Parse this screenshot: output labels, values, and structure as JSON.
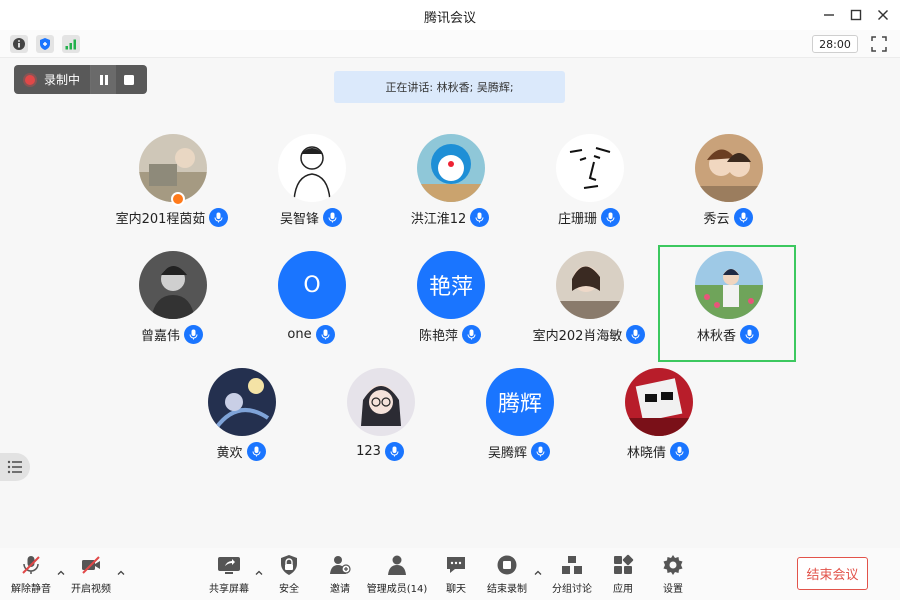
{
  "window": {
    "title": "腾讯会议"
  },
  "topbar": {
    "timer": "28:00"
  },
  "recording": {
    "label": "录制中"
  },
  "speaking": {
    "text": "正在讲话: 林秋香; 吴腾辉;"
  },
  "participants": [
    {
      "name": "室内201程茵茹",
      "avatar": "photo",
      "host": true
    },
    {
      "name": "吴智锋",
      "avatar": "sketch"
    },
    {
      "name": "洪江淮12",
      "avatar": "cartoon"
    },
    {
      "name": "庄珊珊",
      "avatar": "face-doodle"
    },
    {
      "name": "秀云",
      "avatar": "anime"
    },
    {
      "name": "曾嘉伟",
      "avatar": "photo"
    },
    {
      "name": "one",
      "avatar": "text",
      "initials": "O"
    },
    {
      "name": "陈艳萍",
      "avatar": "text",
      "initials": "艳萍"
    },
    {
      "name": "室内202肖海敏",
      "avatar": "photo"
    },
    {
      "name": "林秋香",
      "avatar": "photo",
      "active": true
    },
    {
      "name": "黄欢",
      "avatar": "illustration"
    },
    {
      "name": "123",
      "avatar": "illustration"
    },
    {
      "name": "吴腾辉",
      "avatar": "text",
      "initials": "腾辉"
    },
    {
      "name": "林晓倩",
      "avatar": "photo"
    }
  ],
  "toolbar": {
    "unmute": "解除静音",
    "video": "开启视频",
    "share": "共享屏幕",
    "security": "安全",
    "invite": "邀请",
    "members": "管理成员(14)",
    "chat": "聊天",
    "stop_record": "结束录制",
    "breakout": "分组讨论",
    "apps": "应用",
    "settings": "设置",
    "end_meeting": "结束会议"
  },
  "colors": {
    "accent": "#1a75ff",
    "active_border": "#3cc85f",
    "end_red": "#e2534a",
    "record_red": "#e04848"
  }
}
